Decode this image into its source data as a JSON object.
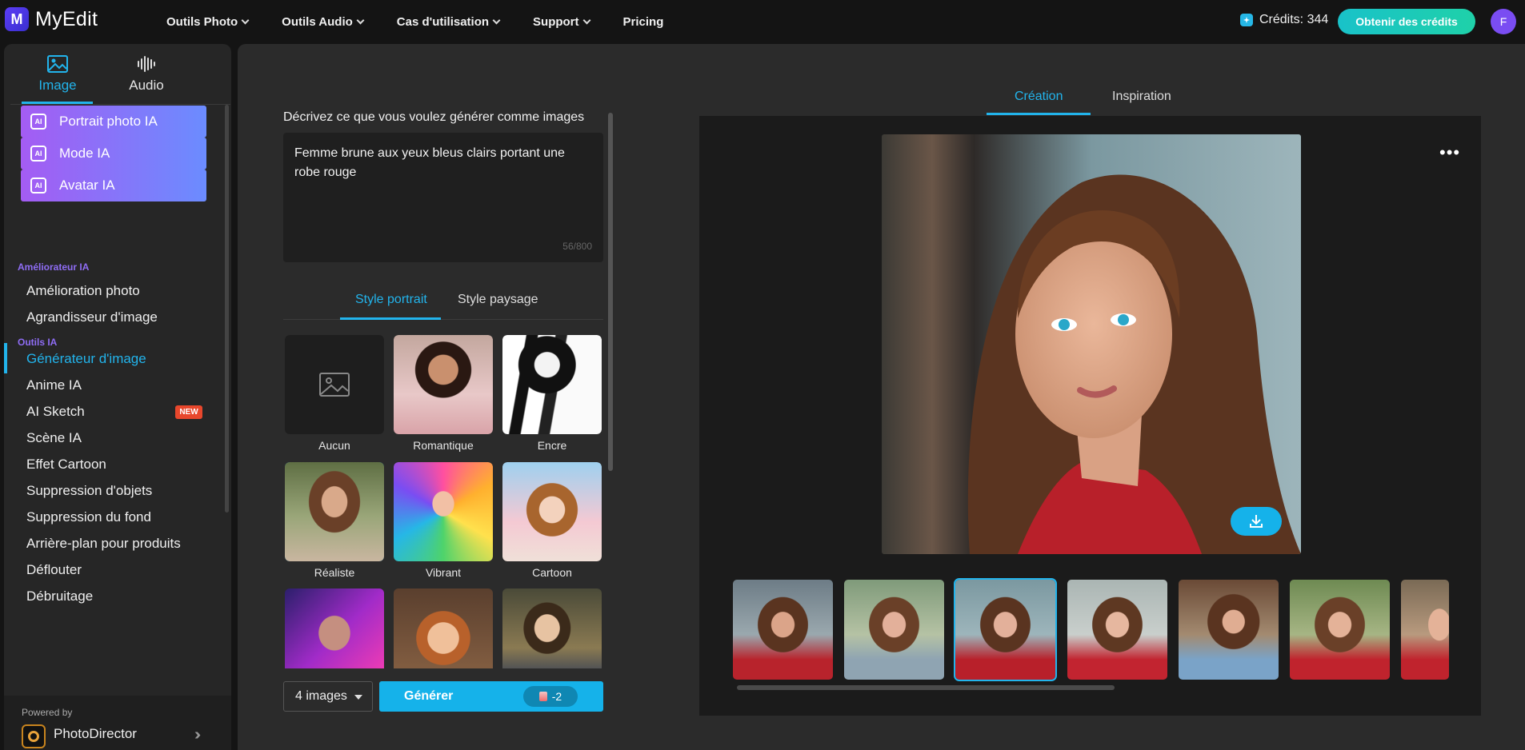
{
  "app": {
    "name": "MyEdit",
    "logo_letter": "M"
  },
  "nav": [
    {
      "label": "Outils Photo",
      "chevron": true
    },
    {
      "label": "Outils Audio",
      "chevron": true
    },
    {
      "label": "Cas d'utilisation",
      "chevron": true
    },
    {
      "label": "Support",
      "chevron": true
    },
    {
      "label": "Pricing",
      "chevron": false
    }
  ],
  "credits": {
    "label": "Crédits: 344"
  },
  "cta_label": "Obtenir des crédits",
  "user_initial": "F",
  "sidebar": {
    "tabs": [
      {
        "label": "Image",
        "active": true
      },
      {
        "label": "Audio",
        "active": false
      }
    ],
    "gradient_buttons": [
      "Portrait photo IA",
      "Mode IA",
      "Avatar IA"
    ],
    "ai_badge": "AI",
    "sections": {
      "enhancer": "Améliorateur IA",
      "tools": "Outils IA"
    },
    "enhancer_items": [
      "Amélioration photo",
      "Agrandisseur d'image"
    ],
    "tool_items": [
      "Générateur d'image",
      "Anime IA",
      "AI Sketch",
      "Scène IA",
      "Effet Cartoon",
      "Suppression d'objets",
      "Suppression du fond",
      "Arrière-plan pour produits",
      "Déflouter",
      "Débruitage"
    ],
    "active_item": "Générateur d'image",
    "new_badge": "NEW",
    "powered_by": "Powered by",
    "product": "PhotoDirector"
  },
  "prompt": {
    "label": "Décrivez ce que vous voulez générer comme images",
    "value": "Femme brune aux yeux bleus clairs portant une robe rouge",
    "count": "56/800"
  },
  "style_tabs": {
    "portrait": "Style portrait",
    "landscape": "Style paysage"
  },
  "styles": [
    "Aucun",
    "Romantique",
    "Encre",
    "Réaliste",
    "Vibrant",
    "Cartoon"
  ],
  "selected_style": "Réaliste",
  "image_count": "4 images",
  "generate": {
    "label": "Générer",
    "cost": "-2"
  },
  "view_tabs": {
    "creation": "Création",
    "inspiration": "Inspiration"
  },
  "more_label": "•••",
  "colors": {
    "accent": "#22b4ec",
    "cta": "#1fd1a9",
    "purple": "#8f6df5"
  }
}
